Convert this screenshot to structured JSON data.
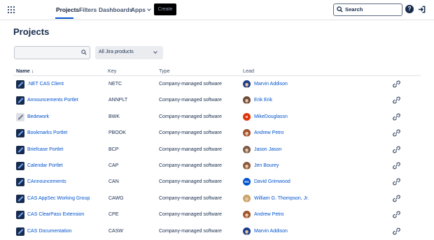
{
  "nav": {
    "items": [
      {
        "label": "Projects",
        "active": true
      },
      {
        "label": "Filters",
        "active": false
      },
      {
        "label": "Dashboards",
        "active": false
      },
      {
        "label": "Apps",
        "active": false
      }
    ],
    "create_label": "Create",
    "search_label": "Search",
    "help_label": "?"
  },
  "page": {
    "title": "Projects",
    "filter_placeholder": "",
    "product_filter": "All Jira products"
  },
  "table": {
    "headers": {
      "name": "Name ↓",
      "key": "Key",
      "type": "Type",
      "lead": "Lead"
    },
    "rows": [
      {
        "name": ".NET CAS Client",
        "key": "NETC",
        "type": "Company-managed software",
        "lead": "Marvin Addison",
        "avatar": {
          "kind": "photo",
          "color": "#1b3e8a"
        }
      },
      {
        "name": "Announcements Portlet",
        "key": "ANNPLT",
        "type": "Company-managed software",
        "lead": "Erik Erik",
        "avatar": {
          "kind": "photo",
          "color": "#6b4a3a"
        }
      },
      {
        "name": "Bedework",
        "key": "BWK",
        "type": "Company-managed software",
        "lead": "MikeDouglassn",
        "avatar": {
          "kind": "initials",
          "text": "M",
          "color": "#de350b"
        }
      },
      {
        "name": "Bookmarks Portlet",
        "key": "PBOOK",
        "type": "Company-managed software",
        "lead": "Andrew Petro",
        "avatar": {
          "kind": "photo",
          "color": "#a0522d"
        }
      },
      {
        "name": "Briefcase Portlet",
        "key": "BCP",
        "type": "Company-managed software",
        "lead": "Jason Jason",
        "avatar": {
          "kind": "photo",
          "color": "#7a5c48"
        }
      },
      {
        "name": "Calendar Portlet",
        "key": "CAP",
        "type": "Company-managed software",
        "lead": "Jen Bourey",
        "avatar": {
          "kind": "photo",
          "color": "#8b5a3c"
        }
      },
      {
        "name": "CAnnouncements",
        "key": "CAN",
        "type": "Company-managed software",
        "lead": "David Grimwood",
        "avatar": {
          "kind": "initials",
          "text": "DG",
          "color": "#0052cc"
        }
      },
      {
        "name": "CAS AppSec Working Group",
        "key": "CAWG",
        "type": "Company-managed software",
        "lead": "William G. Thompson, Jr.",
        "avatar": {
          "kind": "photo",
          "color": "#c9a46b"
        }
      },
      {
        "name": "CAS ClearPass Extension",
        "key": "CPE",
        "type": "Company-managed software",
        "lead": "Andrew Petro",
        "avatar": {
          "kind": "photo",
          "color": "#a0522d"
        }
      },
      {
        "name": "CAS Documentation",
        "key": "CASW",
        "type": "Company-managed software",
        "lead": "Marvin Addison",
        "avatar": {
          "kind": "photo",
          "color": "#1b3e8a"
        }
      }
    ]
  },
  "colors": {
    "link": "#0052cc",
    "text": "#172b4d",
    "nav_accent": "#0052cc"
  }
}
